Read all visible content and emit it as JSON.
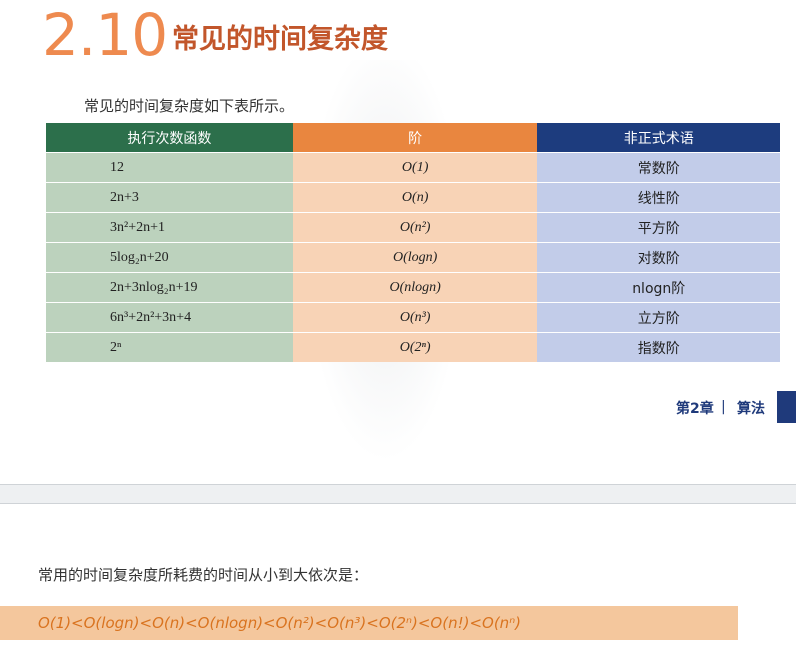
{
  "section": {
    "number": "2.10",
    "title": "常见的时间复杂度",
    "intro": "常见的时间复杂度如下表所示。"
  },
  "table": {
    "headers": [
      "执行次数函数",
      "阶",
      "非正式术语"
    ],
    "rows": [
      [
        "12",
        "O(1)",
        "常数阶"
      ],
      [
        "2n+3",
        "O(n)",
        "线性阶"
      ],
      [
        "3n²+2n+1",
        "O(n²)",
        "平方阶"
      ],
      [
        "5log₂n+20",
        "O(logn)",
        "对数阶"
      ],
      [
        "2n+3nlog₂n+19",
        "O(nlogn)",
        "nlogn阶"
      ],
      [
        "6n³+2n²+3n+4",
        "O(n³)",
        "立方阶"
      ],
      [
        "2ⁿ",
        "O(2ⁿ)",
        "指数阶"
      ]
    ]
  },
  "footer": {
    "chapter": "第2章",
    "separator": "|",
    "chapter_name": "算法"
  },
  "summary": {
    "text": "常用的时间复杂度所耗费的时间从小到大依次是：",
    "order": "O(1)<O(logn)<O(n)<O(nlogn)<O(n²)<O(n³)<O(2ⁿ)<O(n!)<O(nⁿ)"
  },
  "colors": {
    "section_number": "#ee8a4f",
    "section_title": "#c2562b",
    "header_col1": "#2c6f4b",
    "header_col2": "#e9863f",
    "header_col3": "#1d3c7e",
    "highlight_bar": "#f4c79d",
    "order_text": "#d9731f"
  }
}
